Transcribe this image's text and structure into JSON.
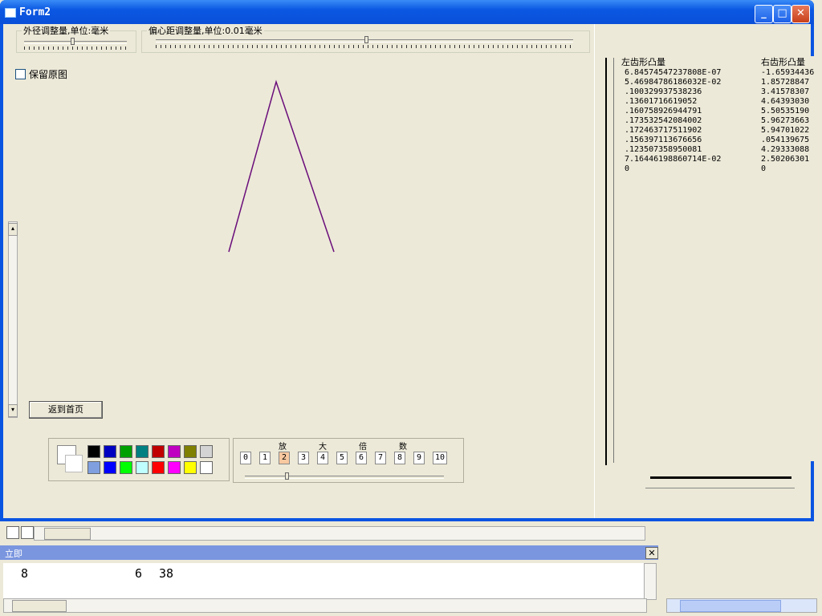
{
  "window": {
    "title": "Form2",
    "minimize": "_",
    "maximize": "□",
    "close": "✕"
  },
  "groups": {
    "outer_diameter": {
      "legend": "外径调整量,单位:毫米",
      "value": 0.45
    },
    "eccentric": {
      "legend": "偏心距调整量,单位:0.01毫米",
      "value": 0.5
    }
  },
  "checkbox": {
    "keep_original": "保留原图"
  },
  "buttons": {
    "return_home": "返到首页"
  },
  "zoom": {
    "chars": [
      "放",
      "大",
      "倍",
      "数"
    ],
    "numbers": [
      "0",
      "1",
      "2",
      "3",
      "4",
      "5",
      "6",
      "7",
      "8",
      "9",
      "10"
    ],
    "selected": "2",
    "value": 0.2
  },
  "palette": {
    "row1": [
      "#000000",
      "#0000c0",
      "#00a000",
      "#008080",
      "#c00000",
      "#c000c0",
      "#808000",
      "#d4d4d4"
    ],
    "row2": [
      "#7f9fdf",
      "#0000ff",
      "#00ff00",
      "#bfffff",
      "#ff0000",
      "#ff00ff",
      "#ffff00",
      "#ffffff"
    ]
  },
  "list": {
    "headers": [
      "左齿形凸量",
      "右齿形凸量"
    ],
    "rows": [
      [
        "6.84574547237808E-07",
        "-1.65934436"
      ],
      [
        "5.46984786186032E-02",
        "1.85728847"
      ],
      [
        ".100329937538236",
        "3.41578307"
      ],
      [
        ".13601716619052",
        "4.64393030"
      ],
      [
        ".160758926944791",
        "5.50535190"
      ],
      [
        ".173532542084002",
        "5.96273663"
      ],
      [
        ".172463717511902",
        "5.94701022"
      ],
      [
        ".156397113676656",
        ".054139675"
      ],
      [
        ".123507358950081",
        "4.29333088"
      ],
      [
        "7.16446198860714E-02",
        "2.50206301"
      ],
      [
        "0",
        "0"
      ]
    ]
  },
  "immediate": {
    "title": "立即",
    "line1": "8",
    "line2": "6",
    "line3": "38",
    "close": "✕"
  },
  "colors": {
    "line": "#6a0d7a"
  }
}
